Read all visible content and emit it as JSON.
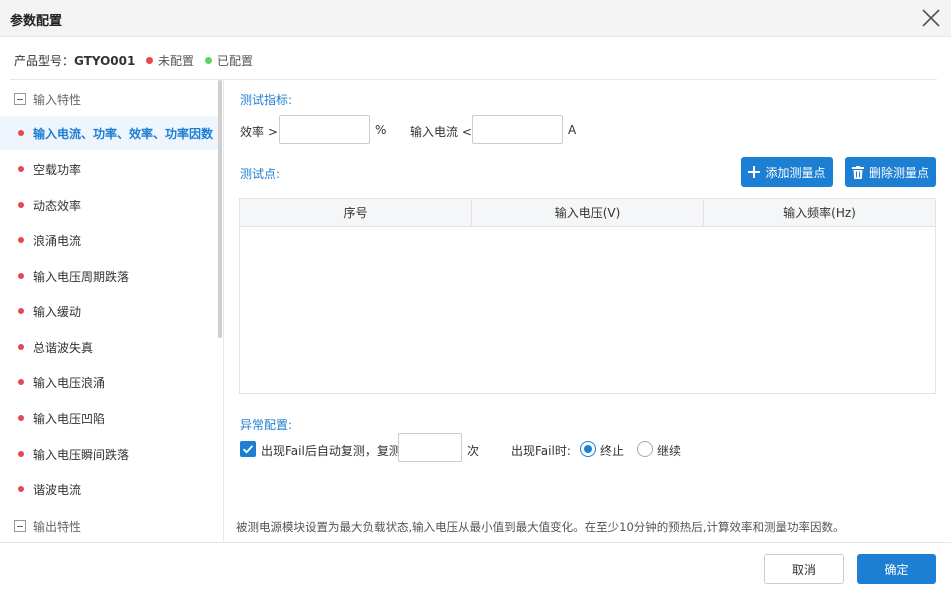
{
  "dialog": {
    "title": "参数配置"
  },
  "product": {
    "label": "产品型号：",
    "model": "GTYO001"
  },
  "legend": {
    "unconfigured": {
      "label": "未配置",
      "color": "#e8474c"
    },
    "configured": {
      "label": "已配置",
      "color": "#5ad45a"
    }
  },
  "sidebar": {
    "group_input": "输入特性",
    "items": [
      {
        "label": "输入电流、功率、效率、功率因数",
        "active": true
      },
      {
        "label": "空载功率"
      },
      {
        "label": "动态效率"
      },
      {
        "label": "浪涌电流"
      },
      {
        "label": "输入电压周期跌落"
      },
      {
        "label": "输入缓动"
      },
      {
        "label": "总谐波失真"
      },
      {
        "label": "输入电压浪涌"
      },
      {
        "label": "输入电压凹陷"
      },
      {
        "label": "输入电压瞬间跌落"
      },
      {
        "label": "谐波电流"
      }
    ],
    "group_output": "输出特性"
  },
  "indicators": {
    "section_label": "测试指标:",
    "efficiency_label": "效率 >",
    "efficiency_value": "",
    "efficiency_unit": "%",
    "current_label": "输入电流 <",
    "current_value": "",
    "current_unit": "A"
  },
  "points": {
    "section_label": "测试点:",
    "add_label": "添加测量点",
    "delete_label": "删除测量点",
    "columns": [
      "序号",
      "输入电压(V)",
      "输入频率(Hz)"
    ],
    "rows": []
  },
  "abnormal": {
    "section_label": "异常配置:",
    "retest_label": "出现Fail后自动复测，复测",
    "retest_value": "",
    "retest_unit": "次",
    "fail_label": "出现Fail时:",
    "option_stop": "终止",
    "option_continue": "继续",
    "selected": "终止",
    "checked": true
  },
  "note": "被测电源模块设置为最大负载状态,输入电压从最小值到最大值变化。在至少10分钟的预热后,计算效率和测量功率因数。",
  "footer": {
    "cancel_label": "取消",
    "ok_label": "确定"
  },
  "colors": {
    "accent": "#1d7fd3",
    "active_bg": "#eef5fc"
  }
}
